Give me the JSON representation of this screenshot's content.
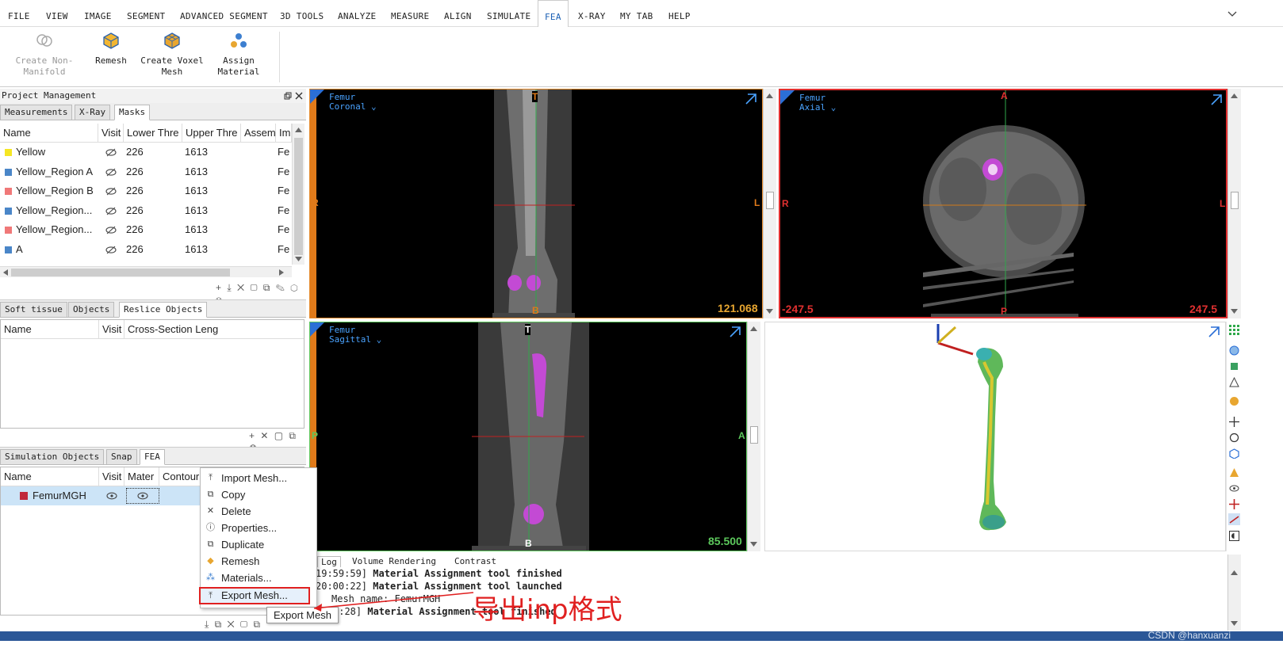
{
  "menu": [
    "FILE",
    "VIEW",
    "IMAGE",
    "SEGMENT",
    "ADVANCED SEGMENT",
    "3D TOOLS",
    "ANALYZE",
    "MEASURE",
    "ALIGN",
    "SIMULATE",
    "FEA",
    "X-RAY",
    "MY TAB",
    "HELP"
  ],
  "ribbon": {
    "create_non_manifold": [
      "Create Non-",
      "Manifold"
    ],
    "remesh": "Remesh",
    "create_voxel_mesh": [
      "Create Voxel",
      "Mesh"
    ],
    "assign_material": [
      "Assign",
      "Material"
    ]
  },
  "project": {
    "title": "Project Management",
    "tabs": [
      "Measurements",
      "X-Ray",
      "Masks"
    ],
    "headers": [
      "Name",
      "Visit",
      "Lower Thre",
      "Upper Thre",
      "Assem",
      "Im"
    ],
    "rows": [
      {
        "name": "Yellow",
        "color": "#f5e623",
        "lower": "226",
        "upper": "1613",
        "im": "Fe"
      },
      {
        "name": "Yellow_Region A",
        "color": "#4a86c8",
        "lower": "226",
        "upper": "1613",
        "im": "Fe"
      },
      {
        "name": "Yellow_Region B",
        "color": "#f07878",
        "lower": "226",
        "upper": "1613",
        "im": "Fe"
      },
      {
        "name": "Yellow_Region...",
        "color": "#4a86c8",
        "lower": "226",
        "upper": "1613",
        "im": "Fe"
      },
      {
        "name": "Yellow_Region...",
        "color": "#f07878",
        "lower": "226",
        "upper": "1613",
        "im": "Fe"
      },
      {
        "name": "A",
        "color": "#4a86c8",
        "lower": "226",
        "upper": "1613",
        "im": "Fe"
      }
    ]
  },
  "objects": {
    "tabs": [
      "Soft tissue",
      "Objects",
      "Reslice Objects"
    ],
    "headers": [
      "Name",
      "Visit",
      "Cross-Section Leng"
    ]
  },
  "simulation": {
    "tabs": [
      "Simulation Objects",
      "Snap",
      "FEA"
    ],
    "headers": [
      "Name",
      "Visit",
      "Mater",
      "Contour"
    ],
    "row": {
      "name": "FemurMGH",
      "color": "#c0283c"
    }
  },
  "context_menu": [
    "Import Mesh...",
    "Copy",
    "Delete",
    "Properties...",
    "Duplicate",
    "Remesh",
    "Materials...",
    "Export Mesh..."
  ],
  "tooltip": "Export Mesh",
  "annotation": "导出inp格式",
  "views": {
    "coronal": {
      "name": "Femur",
      "plane": "Coronal ⌄",
      "value": "121.068",
      "top": "T",
      "bottom": "B",
      "left": "R",
      "right": "L"
    },
    "axial": {
      "name": "Femur",
      "plane": "Axial ⌄",
      "left_value": "-247.5",
      "right_value": "247.5",
      "top": "A",
      "bottom": "P",
      "left": "R",
      "right": "L"
    },
    "sagittal": {
      "name": "Femur",
      "plane": "Sagittal ⌄",
      "value": "85.500",
      "top": "T",
      "bottom": "B",
      "left": "P",
      "right": "A"
    }
  },
  "log": {
    "tabs": [
      "Log",
      "Volume Rendering",
      "Contrast"
    ],
    "lines": [
      {
        "time": "19:59:59]",
        "text": "Material Assignment tool finished"
      },
      {
        "time": "20:00:22]",
        "text": "Material Assignment tool launched"
      },
      {
        "time": "",
        "text": "Mesh name: FemurMGH"
      },
      {
        "time": "0:28]",
        "text": "Material Assignment tool finished"
      }
    ]
  },
  "watermark": "CSDN @hanxuanzi"
}
